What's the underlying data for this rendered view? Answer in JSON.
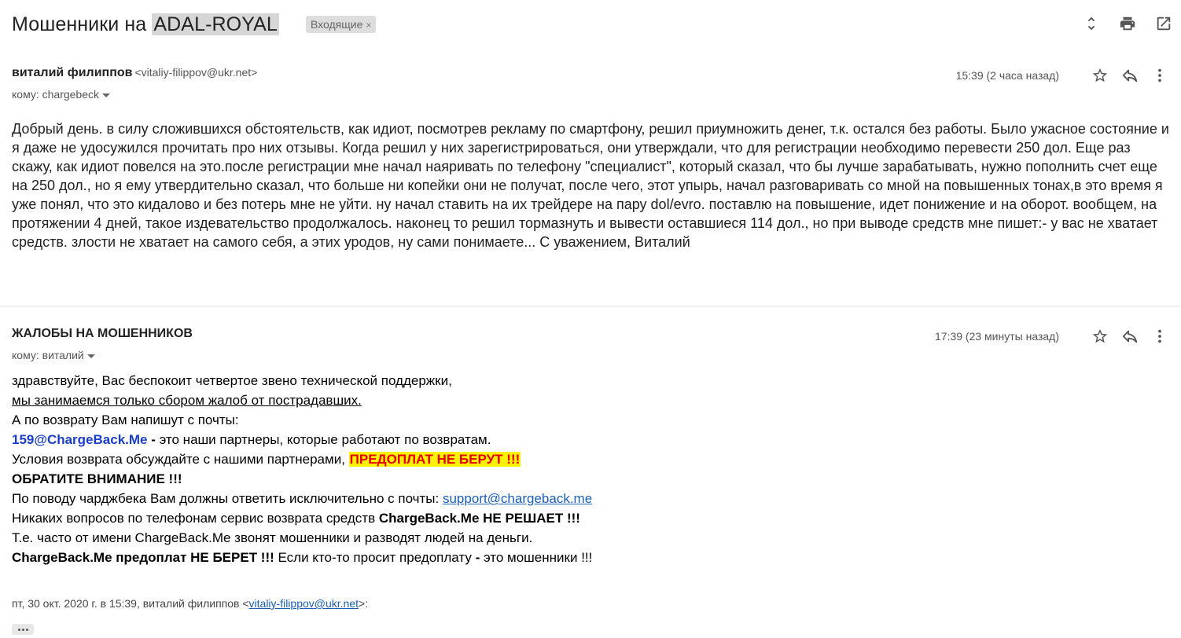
{
  "subject": {
    "prefix": "Мошенники на",
    "highlight": "ADAL-ROYAL",
    "label": "Входящие",
    "label_close": "×"
  },
  "toolbar": {
    "icons": [
      "expand-collapse-icon",
      "print-icon",
      "open-new-window-icon"
    ]
  },
  "messages": [
    {
      "sender_name": "виталий филиппов",
      "sender_email": "<vitaliy-filippov@ukr.net>",
      "to": "кому: chargebeck",
      "time": "15:39 (2 часа назад)",
      "body": "Добрый день. в силу сложившихся обстоятельств, как идиот, посмотрев рекламу по смартфону, решил приумножить денег, т.к. остался без работы. Было ужасное состояние и я даже не удосужился прочитать про них отзывы. Когда решил у них зарегистрироваться, они утверждали, что для регистрации необходимо перевести 250 дол. Еще раз скажу, как идиот повелся на это.после регистрации мне начал наяривать по телефону \"специалист\", который сказал, что бы лучше зарабатывать, нужно пополнить счет еще на 250 дол., но я ему утвердительно сказал, что больше ни копейки они не получат, после чего, этот упырь, начал разговаривать со мной на повышенных тонах,в это время я уже понял, что это кидалово и без потерь мне не уйти. ну начал ставить на их трейдере на пару dol/evro. поставлю на повышение, идет понижение и на оборот. вообщем, на протяжении 4 дней, такое издевательство продолжалось. наконец то решил тормазнуть и вывести оставшиеся 114 дол., но при выводе средств мне пишет:- у вас не хватает средств. злости не хватает на самого себя, а этих уродов, ну сами понимаете... С уважением, Виталий"
    },
    {
      "sender_name": "ЖАЛОБЫ НА МОШЕННИКОВ",
      "to": "кому: виталий",
      "time": "17:39 (23 минуты назад)",
      "lines": {
        "l1": "здравствуйте, Вас беспокоит четвертое звено технической поддержки,",
        "l2": "мы занимаемся только сбором жалоб от пострадавших.",
        "l3": "А по возврату Вам напишут с почты:",
        "l4_email": "159@ChargeBack.Me",
        "l4_dash": " - ",
        "l4_rest": "это наши партнеры, которые работают по возвратам.",
        "l5_text": "Условия возврата обсуждайте с нашими партнерами, ",
        "l5_hl": "ПРЕДОПЛАТ НЕ БЕРУТ !!!",
        "l6": "ОБРАТИТЕ ВНИМАНИЕ !!!",
        "l7_text": "По поводу чарджбека Вам должны ответить исключительно с почты: ",
        "l7_link": "support@chargeback.me",
        "l8_text": "Никаких вопросов по телефонам сервис возврата средств ",
        "l8_bold": "ChargeBack.Me НЕ РЕШАЕТ !!!",
        "l9": "Т.е. часто от имени ChargeBack.Me звонят мошенники и разводят людей на деньги.",
        "l10_bold": "ChargeBack.Me предоплат НЕ БЕРЕТ !!!",
        "l10_text": " Если кто-то просит предоплату ",
        "l10_dash": "-",
        "l10_end": " это мошенники !!!"
      },
      "quote_prefix": "пт, 30 окт. 2020 г. в 15:39, виталий филиппов <",
      "quote_link": "vitaliy-filippov@ukr.net",
      "quote_suffix": ">:"
    }
  ]
}
